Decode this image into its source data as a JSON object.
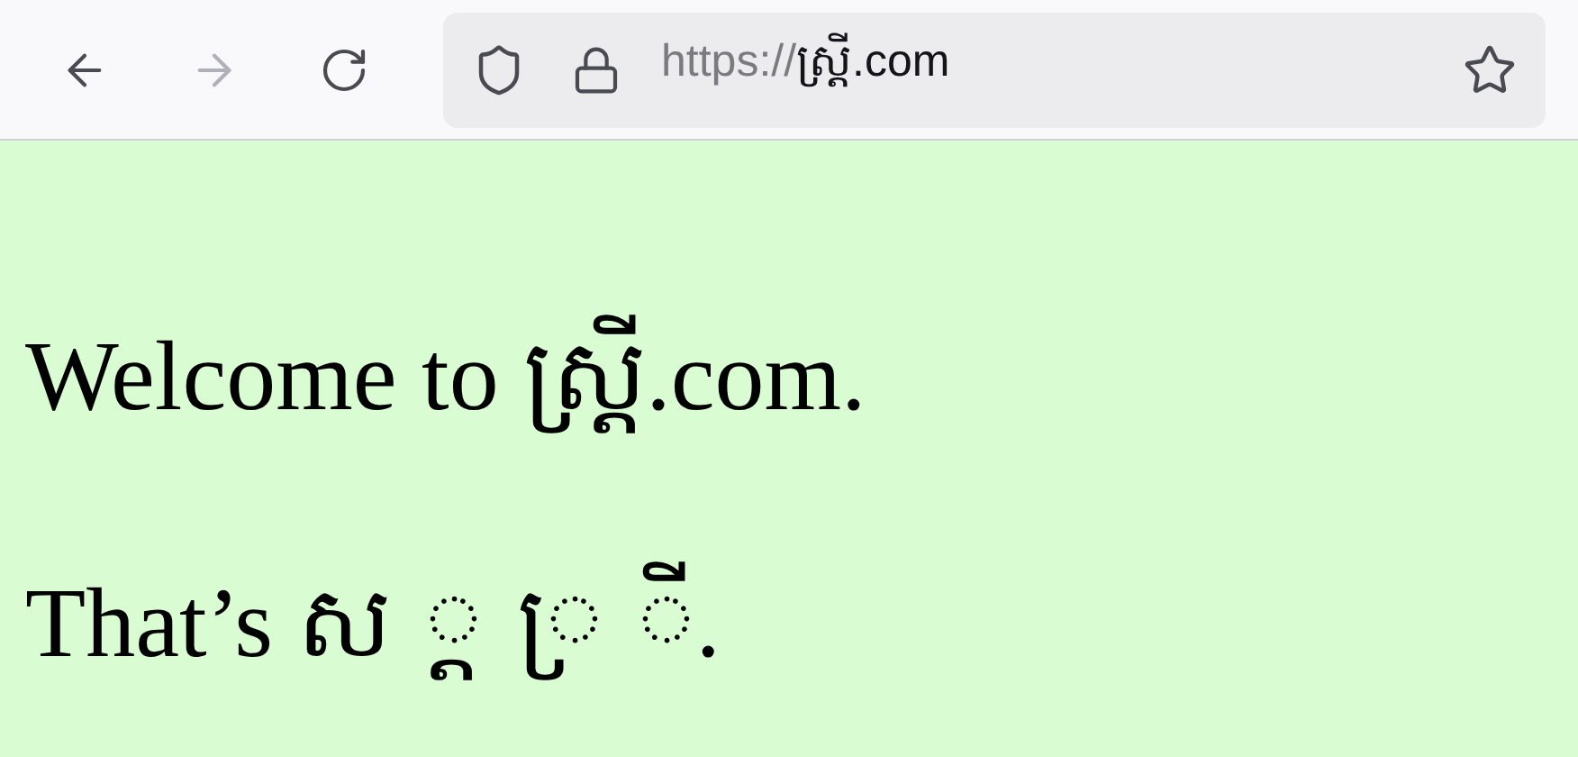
{
  "toolbar": {
    "back": {
      "disabled": false
    },
    "forward": {
      "disabled": true
    },
    "address": {
      "scheme": "https://",
      "host": "ស្ត្រី.com"
    }
  },
  "page": {
    "paragraphs": [
      "Welcome to ស្ត្រី.com.",
      "That’s ស ្ត ្រ ី."
    ]
  }
}
